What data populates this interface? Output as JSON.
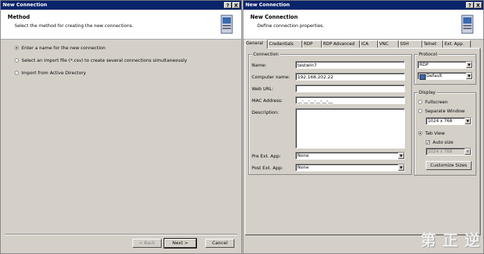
{
  "left_window": {
    "title": "New Connection",
    "buttons": {
      "help": "?",
      "close": "X"
    },
    "header": {
      "title": "Method",
      "subtitle": "Select the method for creating the new connections."
    },
    "options": [
      {
        "label": "Enter a name for the new connection",
        "selected": true
      },
      {
        "label": "Select an import file (*.csv) to create several connections simultaneously",
        "selected": false
      },
      {
        "label": "Import from Active Directory",
        "selected": false
      }
    ],
    "footer": {
      "back": "< Back",
      "next": "Next >",
      "cancel": "Cancel"
    }
  },
  "right_window": {
    "title": "New Connection",
    "buttons": {
      "help": "?",
      "close": "X"
    },
    "header": {
      "title": "New Connection",
      "subtitle": "Define connection properties."
    },
    "tabs": [
      "General",
      "Credentials",
      "RDP",
      "RDP Advanced",
      "ICA",
      "VNC",
      "SSH",
      "Telnet",
      "Ext. App."
    ],
    "active_tab": "General",
    "connection": {
      "group_label": "Connection",
      "name_label": "Name:",
      "name_value": "testwin7",
      "computer_label": "Computer name:",
      "computer_value": "192.168.202.22",
      "weburl_label": "Web URL:",
      "weburl_value": "",
      "mac_label": "MAC Address:",
      "mac_value": "__-__-__-__-__-__",
      "description_label": "Description:",
      "description_value": "",
      "pre_label": "Pre Ext. App:",
      "pre_value": "None",
      "post_label": "Post Ext. App:",
      "post_value": "None"
    },
    "protocol": {
      "group_label": "Protocol",
      "value": "RDP",
      "profile": "Default"
    },
    "display": {
      "group_label": "Display",
      "fullscreen": "Fullscreen",
      "separate": "Separate Window",
      "separate_size": "1024 x 768",
      "tabview": "Tab View",
      "autosize": "Auto size",
      "tab_size": "1024 x 768",
      "customize": "Customize Sizes",
      "selected": "tabview"
    },
    "watermark": "第 正 逆"
  }
}
